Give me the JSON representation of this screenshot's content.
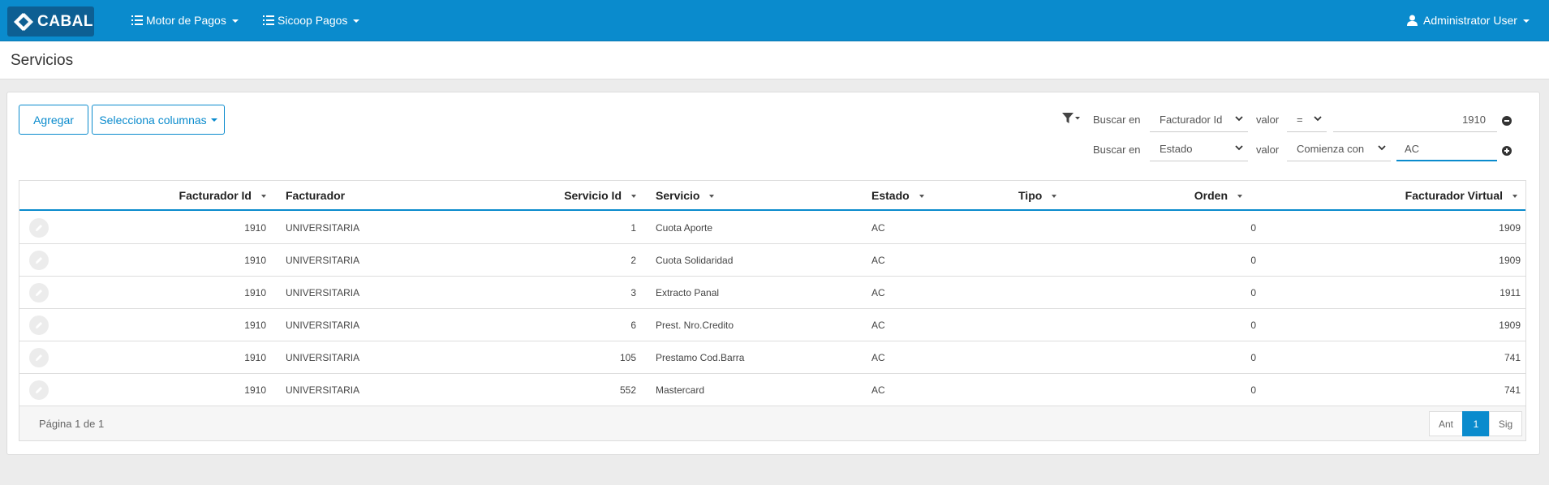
{
  "navbar": {
    "brand": "CABAL",
    "menus": [
      {
        "label": "Motor de Pagos"
      },
      {
        "label": "Sicoop Pagos"
      }
    ],
    "user": "Administrator User"
  },
  "page": {
    "title": "Servicios"
  },
  "toolbar": {
    "add_label": "Agregar",
    "columns_label": "Selecciona columnas"
  },
  "filters": [
    {
      "search_in_label": "Buscar en",
      "field": "Facturador Id",
      "value_label": "valor",
      "operator": "=",
      "value": "1910",
      "action": "remove"
    },
    {
      "search_in_label": "Buscar en",
      "field": "Estado",
      "value_label": "valor",
      "operator": "Comienza con",
      "value": "AC",
      "action": "add"
    }
  ],
  "table": {
    "columns": [
      "Facturador Id",
      "Facturador",
      "Servicio Id",
      "Servicio",
      "Estado",
      "Tipo",
      "Orden",
      "Facturador Virtual"
    ],
    "rows": [
      [
        "1910",
        "UNIVERSITARIA",
        "1",
        "Cuota Aporte",
        "AC",
        "",
        "0",
        "1909"
      ],
      [
        "1910",
        "UNIVERSITARIA",
        "2",
        "Cuota Solidaridad",
        "AC",
        "",
        "0",
        "1909"
      ],
      [
        "1910",
        "UNIVERSITARIA",
        "3",
        "Extracto Panal",
        "AC",
        "",
        "0",
        "1911"
      ],
      [
        "1910",
        "UNIVERSITARIA",
        "6",
        "Prest. Nro.Credito",
        "AC",
        "",
        "0",
        "1909"
      ],
      [
        "1910",
        "UNIVERSITARIA",
        "105",
        "Prestamo Cod.Barra",
        "AC",
        "",
        "0",
        "741"
      ],
      [
        "1910",
        "UNIVERSITARIA",
        "552",
        "Mastercard",
        "AC",
        "",
        "0",
        "741"
      ]
    ]
  },
  "footer": {
    "page_info": "Página 1 de 1",
    "prev": "Ant",
    "current": "1",
    "next": "Sig"
  },
  "colors": {
    "primary": "#0a8bcd",
    "brand_bg": "#0d5f93"
  }
}
